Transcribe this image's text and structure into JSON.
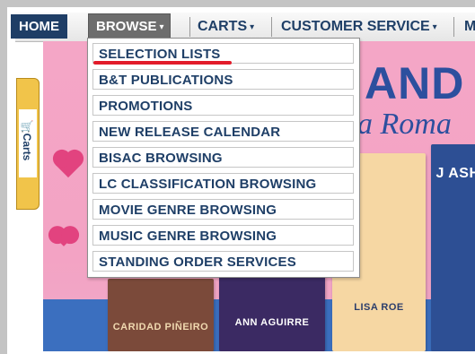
{
  "nav": {
    "home_label": "HOME",
    "browse_label": "BROWSE",
    "carts_label": "CARTS",
    "customer_service_label": "CUSTOMER SERVICE",
    "more_label": "M",
    "caret": "▾"
  },
  "browse_menu": {
    "items": [
      {
        "label": "SELECTION LISTS"
      },
      {
        "label": "B&T PUBLICATIONS"
      },
      {
        "label": "PROMOTIONS"
      },
      {
        "label": "NEW RELEASE CALENDAR"
      },
      {
        "label": "BISAC BROWSING"
      },
      {
        "label": "LC CLASSIFICATION BROWSING"
      },
      {
        "label": "MOVIE GENRE BROWSING"
      },
      {
        "label": "MUSIC GENRE BROWSING"
      },
      {
        "label": "STANDING ORDER SERVICES"
      }
    ]
  },
  "side_tab": {
    "label": "Carts",
    "icon": "cart-icon"
  },
  "banner": {
    "title": "AND",
    "subtitle": "a Roma",
    "books": [
      {
        "author": "CARIDAD PIÑEIRO"
      },
      {
        "author": "ANN AGUIRRE"
      },
      {
        "author": "LISA ROE"
      },
      {
        "author": "J ASH"
      }
    ]
  },
  "colors": {
    "nav_active": "#1f3e66",
    "browse_active": "#6d6d6d",
    "menu_text": "#1f3f67",
    "banner_pink": "#f4a6c6",
    "banner_blue": "#2c4f9e",
    "highlight_red": "#e21b2a"
  }
}
